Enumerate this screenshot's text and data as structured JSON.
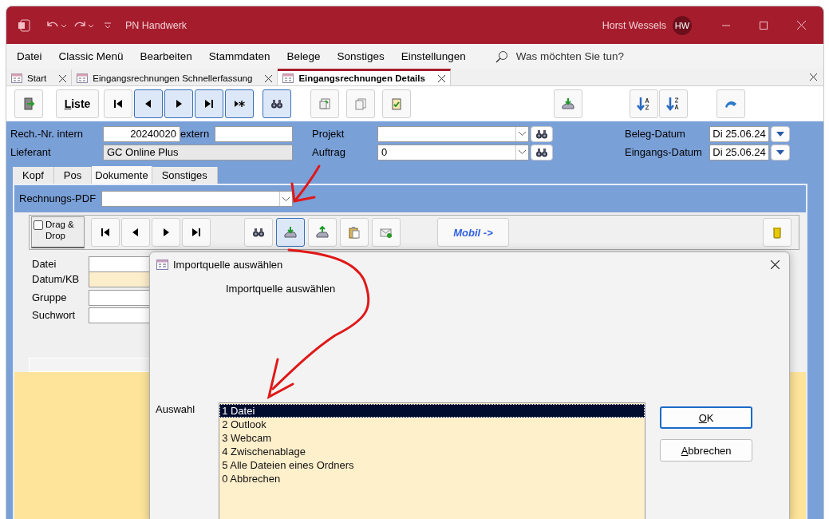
{
  "window": {
    "title": "PN Handwerk",
    "user": "Horst Wessels",
    "user_initials": "HW"
  },
  "menu": [
    "Datei",
    "Classic Menü",
    "Bearbeiten",
    "Stammdaten",
    "Belege",
    "Sonstiges",
    "Einstellungen"
  ],
  "search": {
    "placeholder": "Was möchten Sie tun?"
  },
  "doc_tabs": [
    {
      "label": "Start",
      "selected": false
    },
    {
      "label": "Eingangsrechnungen Schnellerfassung",
      "selected": false
    },
    {
      "label": "Eingangsrechnungen Details",
      "selected": true
    }
  ],
  "toolbar": [
    [
      {
        "kind": "exit",
        "highlighted": false
      }
    ],
    [
      {
        "kind": "text",
        "label": "Liste",
        "highlighted": false
      }
    ],
    [
      {
        "kind": "first",
        "highlighted": false
      },
      {
        "kind": "prev",
        "highlighted": true
      },
      {
        "kind": "next",
        "highlighted": true
      },
      {
        "kind": "last",
        "highlighted": true
      },
      {
        "kind": "new",
        "highlighted": true
      }
    ],
    [
      {
        "kind": "search",
        "highlighted": true
      }
    ],
    [
      {
        "kind": "copy",
        "highlighted": false
      },
      {
        "kind": "pages",
        "highlighted": false
      },
      {
        "kind": "checklist",
        "highlighted": false
      }
    ],
    [
      {
        "kind": "import",
        "highlighted": false
      }
    ],
    [
      {
        "kind": "sort_az",
        "highlighted": false
      },
      {
        "kind": "sort_za",
        "highlighted": false
      }
    ],
    [
      {
        "kind": "hat",
        "highlighted": false
      }
    ]
  ],
  "header": {
    "rech_nr_label": "Rech.-Nr. intern",
    "rech_nr": "20240020",
    "extern_label": "extern",
    "lieferant_label": "Lieferant",
    "lieferant": "GC Online Plus",
    "projekt_label": "Projekt",
    "auftrag_label": "Auftrag",
    "auftrag": "0",
    "beleg_datum_label": "Beleg-Datum",
    "beleg_datum": "Di 25.06.24",
    "eingangs_datum_label": "Eingangs-Datum",
    "eingangs_datum": "Di 25.06.24"
  },
  "form_tabs": [
    {
      "label": "Kopf",
      "selected": false
    },
    {
      "label": "Pos",
      "selected": false
    },
    {
      "label": "Dokumente",
      "selected": true
    },
    {
      "label": "Sonstiges",
      "selected": false
    }
  ],
  "pdf": {
    "label": "Rechnungs-PDF"
  },
  "doc_toolbar": {
    "drag_drop": {
      "label": "Drag & Drop",
      "checked": false
    },
    "groups": [
      [
        {
          "kind": "first",
          "highlighted": false
        },
        {
          "kind": "prev",
          "highlighted": false
        },
        {
          "kind": "next",
          "highlighted": false
        },
        {
          "kind": "last",
          "highlighted": false
        }
      ],
      [
        {
          "kind": "search",
          "highlighted": false
        },
        {
          "kind": "import",
          "highlighted": true
        },
        {
          "kind": "export",
          "highlighted": false
        },
        {
          "kind": "clipboard",
          "highlighted": false
        },
        {
          "kind": "mail",
          "highlighted": false
        }
      ],
      [
        {
          "kind": "link",
          "label": "Mobil ->",
          "highlighted": false
        }
      ],
      [
        {
          "kind": "trash",
          "highlighted": false
        }
      ]
    ]
  },
  "doc_fields": [
    {
      "label": "Datei",
      "tinted": false
    },
    {
      "label": "Datum/KB",
      "tinted": true
    },
    {
      "label": "Gruppe",
      "tinted": false
    },
    {
      "label": "Suchwort",
      "tinted": false
    }
  ],
  "dialog": {
    "title": "Importquelle auswählen",
    "heading": "Importquelle auswählen",
    "list_label": "Auswahl",
    "options": [
      {
        "label": "1 Datei",
        "selected": true
      },
      {
        "label": "2 Outlook",
        "selected": false
      },
      {
        "label": "3 Webcam",
        "selected": false
      },
      {
        "label": "4 Zwischenablage",
        "selected": false
      },
      {
        "label": "5 Alle Dateien eines Ordners",
        "selected": false
      },
      {
        "label": "0 Abbrechen",
        "selected": false
      }
    ],
    "buttons": [
      {
        "label": "OK",
        "default": true
      },
      {
        "label": "Abbrechen",
        "default": false
      }
    ]
  }
}
